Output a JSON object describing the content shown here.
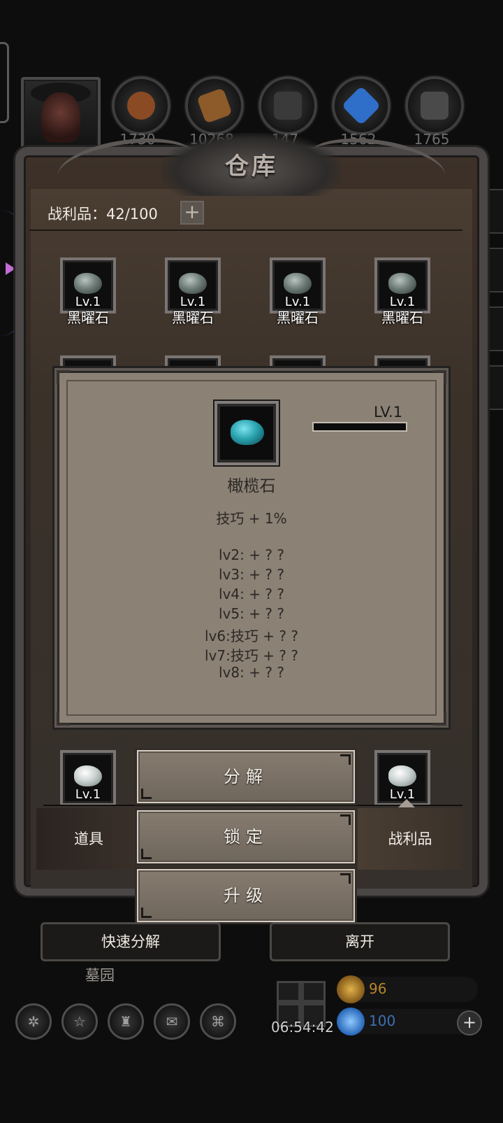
{
  "resources": [
    "1730",
    "10268",
    "147",
    "1562",
    "1765"
  ],
  "warehouse": {
    "title": "仓库",
    "loot_label": "战利品：42/100",
    "plus": "+",
    "items_row1": [
      {
        "lv": "Lv.1",
        "name": "黑曜石"
      },
      {
        "lv": "Lv.1",
        "name": "黑曜石"
      },
      {
        "lv": "Lv.1",
        "name": "黑曜石"
      },
      {
        "lv": "Lv.1",
        "name": "黑曜石"
      }
    ],
    "items_row_bottom": [
      {
        "lv": "Lv.1"
      },
      {
        "lv": "Lv.1"
      }
    ],
    "tabs": {
      "items": "道具",
      "loot": "战利品"
    }
  },
  "detail": {
    "level": "LV.1",
    "name": "橄榄石",
    "stat": "技巧 + 1%",
    "levels": [
      "lv2: + ? ?",
      "lv3: + ? ?",
      "lv4: + ? ?",
      "lv5: + ? ?",
      "lv6:技巧 + ? ?",
      "lv7:技巧 + ? ?",
      "lv8: + ? ?"
    ]
  },
  "actions": {
    "decompose": "分解",
    "lock": "锁定",
    "upgrade": "升级"
  },
  "bottom": {
    "quick_decompose": "快速分解",
    "leave": "离开",
    "location": "墓园",
    "timer": "06:54:42",
    "gold": "96",
    "gems": "100"
  },
  "colors": {
    "olivine": "#2aa3b0",
    "obsidian": "#6f7d79",
    "panel": "#8b8175",
    "gold": "#b8862a",
    "gem": "#2f7fd6"
  }
}
